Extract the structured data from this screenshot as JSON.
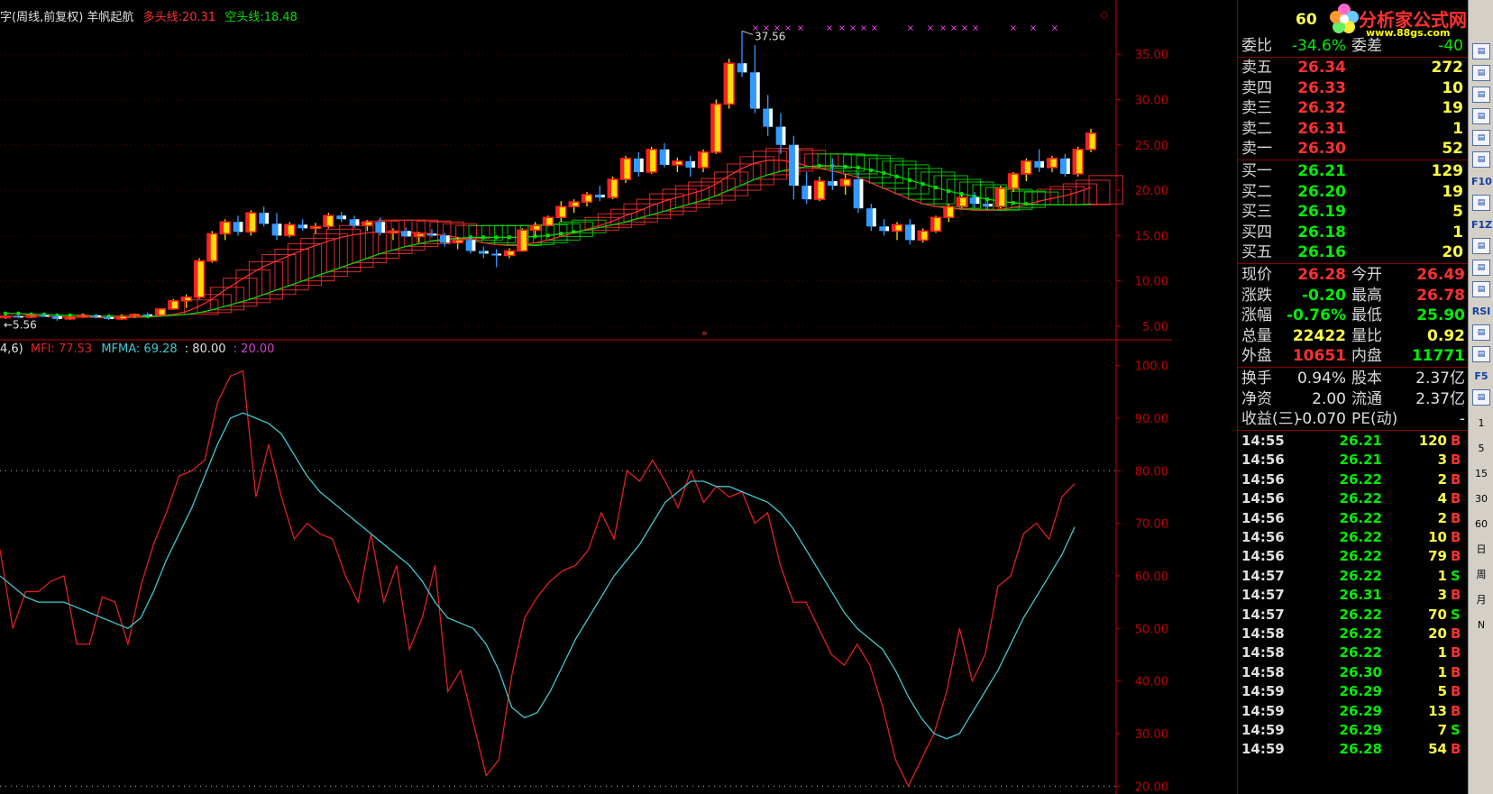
{
  "header": {
    "title": "字(周线,前复权) 羊帆起航",
    "long_label": "多头线:",
    "long_value": "20.31",
    "short_label": "空头线:",
    "short_value": "18.48",
    "price_peak": "37.56",
    "price_low": "5.56",
    "mfi_params": "4,6)",
    "mfi_label": "MFI:",
    "mfi_value": "77.53",
    "mfma_label": "MFMA:",
    "mfma_value": "69.28",
    "line80": ": 80.00",
    "line20": ": 20.00"
  },
  "colors": {
    "up": "#ff2020",
    "up_fill": "#ffdd00",
    "down": "#3399ff",
    "long_line": "#ff3030",
    "short_line": "#00e000",
    "mfi": "#e02020",
    "mfma": "#40c8d0",
    "axis": "#c00000"
  },
  "chart_data": [
    {
      "type": "candlestick",
      "yticks": [
        "35.00",
        "30.00",
        "25.00",
        "20.00",
        "15.00",
        "10.00",
        "5.00"
      ],
      "ylim": [
        4,
        38
      ],
      "candles": [
        [
          6.0,
          6.2,
          5.8,
          6.1
        ],
        [
          6.1,
          6.3,
          5.9,
          6.0
        ],
        [
          6.0,
          6.3,
          5.9,
          6.2
        ],
        [
          6.2,
          6.4,
          6.0,
          6.1
        ],
        [
          6.1,
          6.2,
          5.6,
          5.8
        ],
        [
          5.8,
          6.1,
          5.7,
          6.0
        ],
        [
          6.0,
          6.3,
          5.9,
          6.2
        ],
        [
          6.2,
          6.3,
          5.9,
          6.0
        ],
        [
          6.0,
          6.1,
          5.7,
          5.8
        ],
        [
          5.8,
          6.2,
          5.7,
          6.1
        ],
        [
          6.1,
          6.4,
          6.0,
          6.3
        ],
        [
          6.3,
          6.5,
          6.1,
          6.2
        ],
        [
          6.2,
          7.0,
          6.1,
          6.9
        ],
        [
          6.9,
          8.0,
          6.8,
          7.8
        ],
        [
          7.8,
          8.5,
          7.0,
          8.2
        ],
        [
          8.2,
          12.5,
          8.0,
          12.2
        ],
        [
          12.2,
          15.5,
          12.0,
          15.2
        ],
        [
          15.2,
          16.8,
          14.5,
          16.5
        ],
        [
          16.5,
          17.2,
          15.0,
          15.4
        ],
        [
          15.4,
          17.8,
          15.0,
          17.5
        ],
        [
          17.5,
          18.2,
          16.0,
          16.3
        ],
        [
          16.3,
          17.5,
          14.5,
          15.0
        ],
        [
          15.0,
          16.5,
          14.8,
          16.2
        ],
        [
          16.2,
          16.8,
          15.5,
          15.8
        ],
        [
          15.8,
          16.4,
          15.2,
          16.0
        ],
        [
          16.0,
          17.5,
          15.8,
          17.2
        ],
        [
          17.2,
          17.6,
          16.5,
          16.8
        ],
        [
          16.8,
          17.2,
          15.8,
          16.1
        ],
        [
          16.1,
          16.7,
          15.5,
          16.5
        ],
        [
          16.5,
          17.0,
          15.0,
          15.3
        ],
        [
          15.3,
          15.8,
          14.5,
          15.5
        ],
        [
          15.5,
          15.9,
          14.8,
          14.9
        ],
        [
          14.9,
          15.4,
          14.2,
          15.2
        ],
        [
          15.2,
          15.7,
          14.8,
          15.0
        ],
        [
          15.0,
          15.3,
          13.8,
          14.2
        ],
        [
          14.2,
          14.8,
          13.5,
          14.5
        ],
        [
          14.5,
          14.9,
          13.0,
          13.3
        ],
        [
          13.3,
          13.8,
          12.5,
          13.0
        ],
        [
          13.0,
          13.5,
          11.5,
          12.8
        ],
        [
          12.8,
          13.6,
          12.5,
          13.3
        ],
        [
          13.3,
          15.8,
          13.2,
          15.6
        ],
        [
          15.6,
          16.5,
          15.0,
          16.1
        ],
        [
          16.1,
          17.2,
          16.0,
          17.0
        ],
        [
          17.0,
          18.8,
          16.5,
          18.2
        ],
        [
          18.2,
          19.0,
          17.5,
          18.7
        ],
        [
          18.7,
          19.8,
          18.2,
          19.5
        ],
        [
          19.5,
          20.5,
          18.8,
          19.2
        ],
        [
          19.2,
          21.5,
          19.0,
          21.2
        ],
        [
          21.2,
          23.8,
          20.8,
          23.5
        ],
        [
          23.5,
          24.2,
          21.5,
          22.0
        ],
        [
          22.0,
          24.8,
          21.8,
          24.5
        ],
        [
          24.5,
          25.2,
          22.5,
          22.8
        ],
        [
          22.8,
          23.6,
          22.0,
          23.2
        ],
        [
          23.2,
          23.8,
          21.5,
          22.5
        ],
        [
          22.5,
          24.5,
          22.0,
          24.2
        ],
        [
          24.2,
          30.0,
          24.0,
          29.5
        ],
        [
          29.5,
          34.5,
          29.0,
          34.0
        ],
        [
          34.0,
          37.56,
          32.5,
          33.0
        ],
        [
          33.0,
          36.0,
          28.5,
          29.0
        ],
        [
          29.0,
          30.5,
          26.0,
          27.0
        ],
        [
          27.0,
          28.5,
          24.0,
          25.0
        ],
        [
          25.0,
          26.0,
          19.0,
          20.5
        ],
        [
          20.5,
          22.0,
          18.5,
          19.0
        ],
        [
          19.0,
          21.5,
          18.8,
          21.0
        ],
        [
          21.0,
          23.5,
          20.0,
          20.5
        ],
        [
          20.5,
          21.8,
          19.5,
          21.2
        ],
        [
          21.2,
          22.0,
          17.5,
          18.0
        ],
        [
          18.0,
          18.5,
          15.5,
          16.0
        ],
        [
          16.0,
          16.8,
          15.0,
          15.5
        ],
        [
          15.5,
          16.5,
          14.5,
          16.2
        ],
        [
          16.2,
          16.8,
          14.0,
          14.5
        ],
        [
          14.5,
          15.8,
          14.2,
          15.5
        ],
        [
          15.5,
          17.2,
          15.3,
          17.0
        ],
        [
          17.0,
          18.5,
          16.5,
          18.2
        ],
        [
          18.2,
          19.5,
          18.0,
          19.2
        ],
        [
          19.2,
          19.8,
          18.0,
          18.5
        ],
        [
          18.5,
          19.0,
          17.8,
          18.2
        ],
        [
          18.2,
          20.5,
          18.0,
          20.2
        ],
        [
          20.2,
          22.0,
          19.8,
          21.8
        ],
        [
          21.8,
          23.5,
          21.0,
          23.2
        ],
        [
          23.2,
          24.5,
          22.0,
          22.5
        ],
        [
          22.5,
          23.8,
          22.0,
          23.5
        ],
        [
          23.5,
          24.0,
          21.5,
          21.8
        ],
        [
          21.8,
          24.8,
          21.5,
          24.5
        ],
        [
          24.5,
          26.78,
          24.2,
          26.28
        ]
      ],
      "long_line": [
        6.1,
        6.1,
        6.1,
        6.1,
        6.0,
        6.0,
        6.0,
        6.0,
        5.9,
        5.9,
        6.0,
        6.0,
        6.1,
        6.3,
        6.6,
        7.2,
        8.0,
        9.0,
        9.9,
        10.8,
        11.6,
        12.2,
        12.8,
        13.4,
        13.9,
        14.4,
        14.8,
        15.1,
        15.3,
        15.4,
        15.4,
        15.4,
        15.3,
        15.2,
        15.0,
        14.8,
        14.5,
        14.2,
        14.0,
        13.9,
        14.0,
        14.2,
        14.5,
        14.9,
        15.3,
        15.7,
        16.1,
        16.6,
        17.2,
        17.7,
        18.3,
        18.8,
        19.2,
        19.6,
        20.0,
        20.7,
        21.6,
        22.4,
        23.0,
        23.3,
        23.3,
        23.1,
        22.7,
        22.4,
        22.1,
        21.8,
        21.4,
        20.8,
        20.2,
        19.6,
        19.0,
        18.5,
        18.2,
        18.0,
        17.9,
        17.8,
        17.8,
        17.9,
        18.1,
        18.4,
        18.8,
        19.1,
        19.4,
        19.8,
        20.31
      ],
      "short_line": [
        6.4,
        6.4,
        6.3,
        6.3,
        6.2,
        6.2,
        6.2,
        6.1,
        6.1,
        6.1,
        6.1,
        6.1,
        6.1,
        6.2,
        6.3,
        6.5,
        6.8,
        7.2,
        7.6,
        8.0,
        8.5,
        9.0,
        9.5,
        10.0,
        10.5,
        11.0,
        11.5,
        12.0,
        12.5,
        13.0,
        13.4,
        13.8,
        14.1,
        14.4,
        14.6,
        14.7,
        14.8,
        14.8,
        14.8,
        14.8,
        14.8,
        14.9,
        15.0,
        15.2,
        15.4,
        15.6,
        15.9,
        16.2,
        16.5,
        16.9,
        17.3,
        17.7,
        18.1,
        18.5,
        18.9,
        19.4,
        20.0,
        20.6,
        21.2,
        21.7,
        22.1,
        22.4,
        22.6,
        22.7,
        22.7,
        22.6,
        22.5,
        22.2,
        21.9,
        21.5,
        21.1,
        20.7,
        20.3,
        19.9,
        19.6,
        19.3,
        19.0,
        18.8,
        18.6,
        18.5,
        18.4,
        18.4,
        18.4,
        18.4,
        18.48
      ]
    },
    {
      "type": "line",
      "yticks": [
        "100.0",
        "90.00",
        "80.00",
        "70.00",
        "60.00",
        "50.00",
        "40.00",
        "30.00",
        "20.00"
      ],
      "ylim": [
        18.5,
        102
      ],
      "levels": [
        80,
        20
      ],
      "series": [
        {
          "name": "MFI",
          "values": [
            65,
            50,
            57,
            57,
            59,
            60,
            47,
            47,
            56,
            55,
            47,
            58,
            66,
            72,
            79,
            80,
            82,
            93,
            98,
            99,
            75,
            85,
            75,
            67,
            70,
            68,
            67,
            60,
            55,
            68,
            55,
            62,
            46,
            52,
            62,
            38,
            42,
            32,
            22,
            25,
            41,
            52,
            56,
            59,
            61,
            62,
            65,
            72,
            67,
            80,
            78,
            82,
            78,
            73,
            80,
            74,
            77,
            75,
            76,
            70,
            72,
            62,
            55,
            55,
            50,
            45,
            43,
            47,
            43,
            35,
            25,
            20,
            25,
            30,
            38,
            50,
            40,
            45,
            58,
            60,
            68,
            70,
            67,
            75,
            77.53
          ]
        },
        {
          "name": "MFMA",
          "values": [
            60,
            58,
            56,
            55,
            55,
            55,
            54,
            53,
            52,
            51,
            50,
            52,
            57,
            63,
            68,
            73,
            79,
            85,
            90,
            91,
            90,
            89,
            87,
            83,
            79,
            76,
            74,
            72,
            70,
            68,
            66,
            64,
            62,
            59,
            55,
            52,
            51,
            50,
            47,
            42,
            35,
            33,
            34,
            38,
            43,
            48,
            52,
            56,
            60,
            63,
            66,
            70,
            74,
            76,
            78,
            78,
            77,
            77,
            76,
            75,
            74,
            72,
            69,
            65,
            61,
            57,
            53,
            50,
            48,
            46,
            42,
            37,
            33,
            30,
            29,
            30,
            34,
            38,
            42,
            47,
            52,
            56,
            60,
            64,
            69.28
          ]
        }
      ]
    }
  ],
  "quotes": {
    "weibi_label": "委比",
    "weibi_value": "-34.6%",
    "weicha_label": "委差",
    "weicha_value": "-40",
    "sell": [
      {
        "label": "卖五",
        "price": "26.34",
        "vol": "272"
      },
      {
        "label": "卖四",
        "price": "26.33",
        "vol": "10"
      },
      {
        "label": "卖三",
        "price": "26.32",
        "vol": "19"
      },
      {
        "label": "卖二",
        "price": "26.31",
        "vol": "1"
      },
      {
        "label": "卖一",
        "price": "26.30",
        "vol": "52"
      }
    ],
    "buy": [
      {
        "label": "买一",
        "price": "26.21",
        "vol": "129"
      },
      {
        "label": "买二",
        "price": "26.20",
        "vol": "19"
      },
      {
        "label": "买三",
        "price": "26.19",
        "vol": "5"
      },
      {
        "label": "买四",
        "price": "26.18",
        "vol": "1"
      },
      {
        "label": "买五",
        "price": "26.16",
        "vol": "20"
      }
    ],
    "stats1": [
      {
        "l1": "现价",
        "v1": "26.28",
        "c1": "#ff3030",
        "l2": "今开",
        "v2": "26.49",
        "c2": "#ff3030"
      },
      {
        "l1": "涨跌",
        "v1": "-0.20",
        "c1": "#00ee00",
        "l2": "最高",
        "v2": "26.78",
        "c2": "#ff3030"
      },
      {
        "l1": "涨幅",
        "v1": "-0.76%",
        "c1": "#00ee00",
        "l2": "最低",
        "v2": "25.90",
        "c2": "#00ee00"
      },
      {
        "l1": "总量",
        "v1": "22422",
        "c1": "#ffff44",
        "l2": "量比",
        "v2": "0.92",
        "c2": "#ffff44"
      },
      {
        "l1": "外盘",
        "v1": "10651",
        "c1": "#ff3030",
        "l2": "内盘",
        "v2": "11771",
        "c2": "#00ee00"
      }
    ],
    "stats2": [
      {
        "l1": "换手",
        "v1": "0.94%",
        "c1": "#e0e0e0",
        "l2": "股本",
        "v2": "2.37亿",
        "c2": "#e0e0e0"
      },
      {
        "l1": "净资",
        "v1": "2.00",
        "c1": "#e0e0e0",
        "l2": "流通",
        "v2": "2.37亿",
        "c2": "#e0e0e0"
      },
      {
        "l1": "收益(三)",
        "v1": "-0.070",
        "c1": "#e0e0e0",
        "l2": "PE(动)",
        "v2": "-",
        "c2": "#e0e0e0"
      }
    ],
    "ticks": [
      {
        "t": "14:55",
        "p": "26.21",
        "v": "120",
        "d": "B"
      },
      {
        "t": "14:56",
        "p": "26.21",
        "v": "3",
        "d": "B"
      },
      {
        "t": "14:56",
        "p": "26.22",
        "v": "2",
        "d": "B"
      },
      {
        "t": "14:56",
        "p": "26.22",
        "v": "4",
        "d": "B"
      },
      {
        "t": "14:56",
        "p": "26.22",
        "v": "2",
        "d": "B"
      },
      {
        "t": "14:56",
        "p": "26.22",
        "v": "10",
        "d": "B"
      },
      {
        "t": "14:56",
        "p": "26.22",
        "v": "79",
        "d": "B"
      },
      {
        "t": "14:57",
        "p": "26.22",
        "v": "1",
        "d": "S"
      },
      {
        "t": "14:57",
        "p": "26.31",
        "v": "3",
        "d": "B"
      },
      {
        "t": "14:57",
        "p": "26.22",
        "v": "70",
        "d": "S"
      },
      {
        "t": "14:58",
        "p": "26.22",
        "v": "20",
        "d": "B"
      },
      {
        "t": "14:58",
        "p": "26.22",
        "v": "1",
        "d": "B"
      },
      {
        "t": "14:58",
        "p": "26.30",
        "v": "1",
        "d": "B"
      },
      {
        "t": "14:59",
        "p": "26.29",
        "v": "5",
        "d": "B"
      },
      {
        "t": "14:59",
        "p": "26.29",
        "v": "13",
        "d": "B"
      },
      {
        "t": "14:59",
        "p": "26.29",
        "v": "7",
        "d": "S"
      },
      {
        "t": "14:59",
        "p": "26.28",
        "v": "54",
        "d": "B"
      }
    ]
  },
  "logo": {
    "number": "60",
    "brand": "分析家公式网",
    "url": "www.88gs.com"
  },
  "toolbar": {
    "items": [
      "icon",
      "icon",
      "icon",
      "icon",
      "icon",
      "icon",
      "F10",
      "icon",
      "F1Z",
      "icon",
      "icon",
      "icon",
      "RSI",
      "icon",
      "icon",
      "F5",
      "icon",
      "1",
      "5",
      "15",
      "30",
      "60",
      "日",
      "周",
      "月",
      "N"
    ]
  }
}
